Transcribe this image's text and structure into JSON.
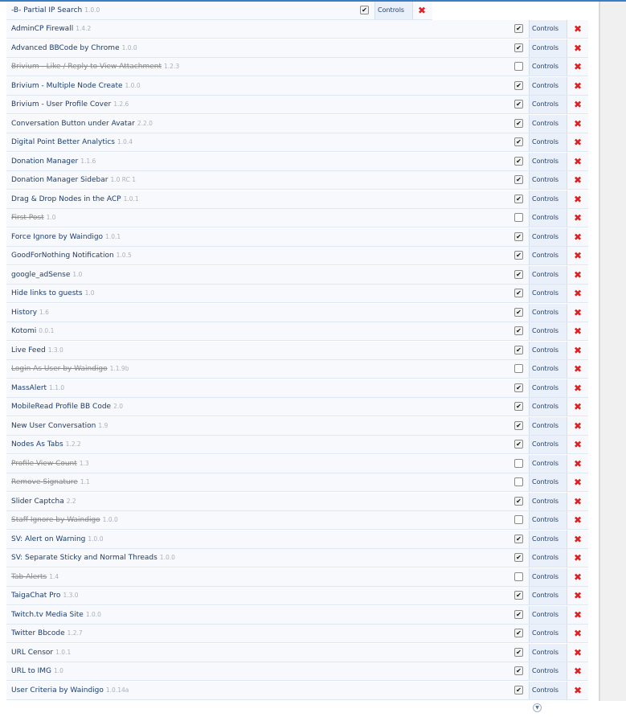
{
  "controls_label": "Controls",
  "addons": [
    {
      "name": "-B- Partial IP Search",
      "version": "1.0.0",
      "enabled": true
    },
    {
      "name": "AdminCP Firewall",
      "version": "1.4.2",
      "enabled": true
    },
    {
      "name": "Advanced BBCode by Chrome",
      "version": "1.0.0",
      "enabled": true
    },
    {
      "name": "Brivium - Like / Reply to View Attachment",
      "version": "1.2.3",
      "enabled": false
    },
    {
      "name": "Brivium - Multiple Node Create",
      "version": "1.0.0",
      "enabled": true
    },
    {
      "name": "Brivium - User Profile Cover",
      "version": "1.2.6",
      "enabled": true
    },
    {
      "name": "Conversation Button under Avatar",
      "version": "2.2.0",
      "enabled": true
    },
    {
      "name": "Digital Point Better Analytics",
      "version": "1.0.4",
      "enabled": true
    },
    {
      "name": "Donation Manager",
      "version": "1.1.6",
      "enabled": true
    },
    {
      "name": "Donation Manager Sidebar",
      "version": "1.0 RC 1",
      "enabled": true
    },
    {
      "name": "Drag & Drop Nodes in the ACP",
      "version": "1.0.1",
      "enabled": true
    },
    {
      "name": "First Post",
      "version": "1.0",
      "enabled": false
    },
    {
      "name": "Force Ignore by Waindigo",
      "version": "1.0.1",
      "enabled": true
    },
    {
      "name": "GoodForNothing Notification",
      "version": "1.0.5",
      "enabled": true
    },
    {
      "name": "google_adSense",
      "version": "1.0",
      "enabled": true
    },
    {
      "name": "Hide links to guests",
      "version": "1.0",
      "enabled": true
    },
    {
      "name": "History",
      "version": "1.6",
      "enabled": true
    },
    {
      "name": "Kotomi",
      "version": "0.0.1",
      "enabled": true
    },
    {
      "name": "Live Feed",
      "version": "1.3.0",
      "enabled": true
    },
    {
      "name": "Login As User by Waindigo",
      "version": "1.1.9b",
      "enabled": false
    },
    {
      "name": "MassAlert",
      "version": "1.1.0",
      "enabled": true
    },
    {
      "name": "MobileRead Profile BB Code",
      "version": "2.0",
      "enabled": true
    },
    {
      "name": "New User Conversation",
      "version": "1.9",
      "enabled": true
    },
    {
      "name": "Nodes As Tabs",
      "version": "1.2.2",
      "enabled": true
    },
    {
      "name": "Profile View Count",
      "version": "1.3",
      "enabled": false
    },
    {
      "name": "Remove Signature",
      "version": "1.1",
      "enabled": false
    },
    {
      "name": "Slider Captcha",
      "version": "2.2",
      "enabled": true
    },
    {
      "name": "Staff Ignore by Waindigo",
      "version": "1.0.0",
      "enabled": false
    },
    {
      "name": "SV: Alert on Warning",
      "version": "1.0.0",
      "enabled": true
    },
    {
      "name": "SV: Separate Sticky and Normal Threads",
      "version": "1.0.0",
      "enabled": true
    },
    {
      "name": "Tab Alerts",
      "version": "1.4",
      "enabled": false
    },
    {
      "name": "TaigaChat Pro",
      "version": "1.3.0",
      "enabled": true
    },
    {
      "name": "Twitch.tv Media Site",
      "version": "1.0.0",
      "enabled": true
    },
    {
      "name": "Twitter Bbcode",
      "version": "1.2.7",
      "enabled": true
    },
    {
      "name": "URL Censor",
      "version": "1.0.1",
      "enabled": true
    },
    {
      "name": "URL to IMG",
      "version": "1.0",
      "enabled": true
    },
    {
      "name": "User Criteria by Waindigo",
      "version": "1.0.14a",
      "enabled": true
    }
  ]
}
